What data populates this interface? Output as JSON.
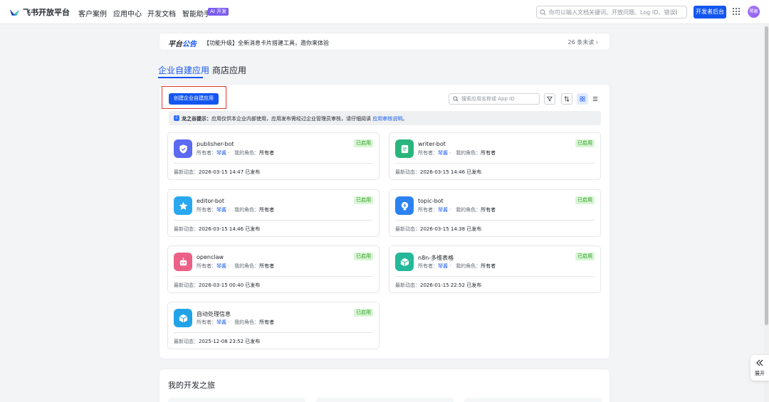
{
  "header": {
    "brand": "飞书开放平台",
    "nav": [
      "客户案例",
      "应用中心",
      "开发文档",
      "智能助手"
    ],
    "ai_badge": "AI 开发",
    "search_placeholder": "你可以输入文档关键词、开放问题、Log ID、错误码",
    "dev_console_label": "开发者后台",
    "avatar_text": "琴酱",
    "icons": [
      "logo-icon",
      "search-icon",
      "apps-grid-icon"
    ]
  },
  "announcement": {
    "brand_part1": "平台",
    "brand_part2": "公告",
    "text": "【功能升级】全新消息卡片搭建工具，邀你来体验",
    "unread": "26 条未读 ›"
  },
  "tabs": [
    {
      "label": "企业自建应用",
      "active": true
    },
    {
      "label": "商店应用",
      "active": false
    }
  ],
  "toolbar": {
    "create_label": "创建企业自建应用",
    "search_placeholder": "搜索应用名称或 App ID",
    "icons": [
      "filter-icon",
      "sort-icon",
      "card-view-icon",
      "list-view-icon"
    ]
  },
  "tip": {
    "label": "龙之谷提示：",
    "text": "应用仅供本企业内部使用，应用发布需经过企业管理员审核，请仔细阅读 ",
    "link": "应用审核说明",
    "end": "。"
  },
  "card_labels": {
    "owner": "所有者：",
    "role": "我的角色：",
    "updated": "最新动态："
  },
  "apps": [
    {
      "name": "publisher-bot",
      "owner": "琴酱",
      "role": "所有者",
      "status": "已启用",
      "updated": "2026-03-15 14:47 已发布",
      "icon": "shield-check-icon",
      "color": "#5b6af0"
    },
    {
      "name": "writer-bot",
      "owner": "琴酱",
      "role": "所有者",
      "status": "已启用",
      "updated": "2026-03-15 14:46 已发布",
      "icon": "document-icon",
      "color": "#2ab57d"
    },
    {
      "name": "editor-bot",
      "owner": "琴酱",
      "role": "所有者",
      "status": "已启用",
      "updated": "2026-03-15 14:46 已发布",
      "icon": "star-icon",
      "color": "#29a8f0"
    },
    {
      "name": "topic-bot",
      "owner": "琴酱",
      "role": "所有者",
      "status": "已启用",
      "updated": "2026-03-15 14:38 已发布",
      "icon": "lightbulb-icon",
      "color": "#2b82f0"
    },
    {
      "name": "openclaw",
      "owner": "琴酱",
      "role": "所有者",
      "status": "已启用",
      "updated": "2026-03-15 00:40 已发布",
      "icon": "robot-icon",
      "color": "#ec5f86"
    },
    {
      "name": "n8n-多维表格",
      "owner": "琴酱",
      "role": "所有者",
      "status": "已启用",
      "updated": "2026-01-15 22:52 已发布",
      "icon": "cube-icon",
      "color": "#25b89a"
    },
    {
      "name": "自动处理信息",
      "owner": "琴酱",
      "role": "所有者",
      "status": "已启用",
      "updated": "2025-12-08 23:52 已发布",
      "icon": "cube-icon",
      "color": "#21a3e8"
    }
  ],
  "journey": {
    "title": "我的开发之旅"
  },
  "expand": {
    "label": "展开",
    "icon": "double-chevron-left-icon"
  },
  "colors": {
    "primary": "#1456f0",
    "status_bg": "#d9f5d6",
    "status_text": "#2ea121",
    "highlight": "#e53935"
  }
}
